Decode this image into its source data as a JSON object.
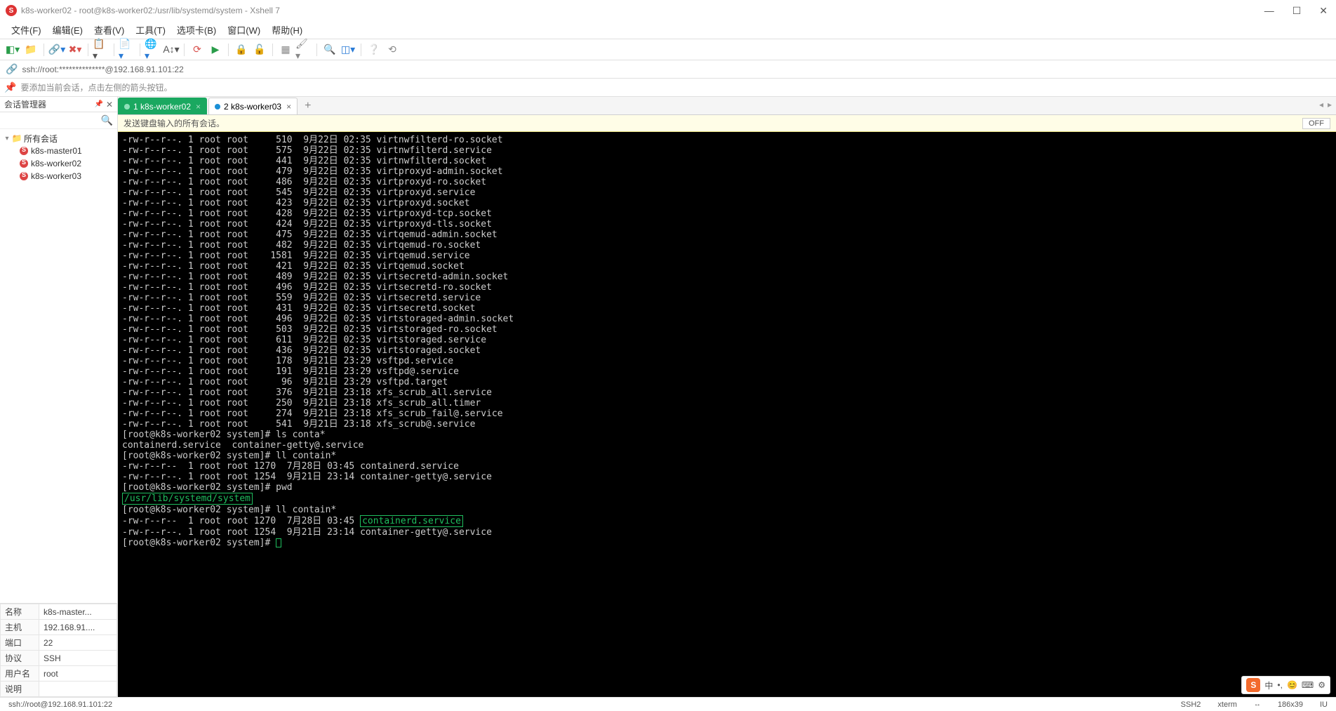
{
  "window": {
    "title": "k8s-worker02 - root@k8s-worker02:/usr/lib/systemd/system - Xshell 7",
    "min": "—",
    "max": "☐",
    "close": "✕"
  },
  "menu": {
    "file": "文件(F)",
    "edit": "编辑(E)",
    "view": "查看(V)",
    "tools": "工具(T)",
    "tabs": "选项卡(B)",
    "window": "窗口(W)",
    "help": "帮助(H)"
  },
  "address": "ssh://root:**************@192.168.91.101:22",
  "hint": "要添加当前会话，点击左侧的箭头按钮。",
  "side": {
    "title": "会话管理器",
    "root": "所有会话",
    "items": [
      "k8s-master01",
      "k8s-worker02",
      "k8s-worker03"
    ]
  },
  "props": {
    "name_k": "名称",
    "name_v": "k8s-master...",
    "host_k": "主机",
    "host_v": "192.168.91....",
    "port_k": "端口",
    "port_v": "22",
    "proto_k": "协议",
    "proto_v": "SSH",
    "user_k": "用户名",
    "user_v": "root",
    "desc_k": "说明",
    "desc_v": ""
  },
  "tabs": {
    "t1": "1 k8s-worker02",
    "t2": "2 k8s-worker03"
  },
  "bcast": {
    "text": "发送键盘输入的所有会话。",
    "off": "OFF"
  },
  "terminal": {
    "ls_lines": [
      "-rw-r--r--. 1 root root     510  9月22日 02:35 virtnwfilterd-ro.socket",
      "-rw-r--r--. 1 root root     575  9月22日 02:35 virtnwfilterd.service",
      "-rw-r--r--. 1 root root     441  9月22日 02:35 virtnwfilterd.socket",
      "-rw-r--r--. 1 root root     479  9月22日 02:35 virtproxyd-admin.socket",
      "-rw-r--r--. 1 root root     486  9月22日 02:35 virtproxyd-ro.socket",
      "-rw-r--r--. 1 root root     545  9月22日 02:35 virtproxyd.service",
      "-rw-r--r--. 1 root root     423  9月22日 02:35 virtproxyd.socket",
      "-rw-r--r--. 1 root root     428  9月22日 02:35 virtproxyd-tcp.socket",
      "-rw-r--r--. 1 root root     424  9月22日 02:35 virtproxyd-tls.socket",
      "-rw-r--r--. 1 root root     475  9月22日 02:35 virtqemud-admin.socket",
      "-rw-r--r--. 1 root root     482  9月22日 02:35 virtqemud-ro.socket",
      "-rw-r--r--. 1 root root    1581  9月22日 02:35 virtqemud.service",
      "-rw-r--r--. 1 root root     421  9月22日 02:35 virtqemud.socket",
      "-rw-r--r--. 1 root root     489  9月22日 02:35 virtsecretd-admin.socket",
      "-rw-r--r--. 1 root root     496  9月22日 02:35 virtsecretd-ro.socket",
      "-rw-r--r--. 1 root root     559  9月22日 02:35 virtsecretd.service",
      "-rw-r--r--. 1 root root     431  9月22日 02:35 virtsecretd.socket",
      "-rw-r--r--. 1 root root     496  9月22日 02:35 virtstoraged-admin.socket",
      "-rw-r--r--. 1 root root     503  9月22日 02:35 virtstoraged-ro.socket",
      "-rw-r--r--. 1 root root     611  9月22日 02:35 virtstoraged.service",
      "-rw-r--r--. 1 root root     436  9月22日 02:35 virtstoraged.socket",
      "-rw-r--r--. 1 root root     178  9月21日 23:29 vsftpd.service",
      "-rw-r--r--. 1 root root     191  9月21日 23:29 vsftpd@.service",
      "-rw-r--r--. 1 root root      96  9月21日 23:29 vsftpd.target",
      "-rw-r--r--. 1 root root     376  9月21日 23:18 xfs_scrub_all.service",
      "-rw-r--r--. 1 root root     250  9月21日 23:18 xfs_scrub_all.timer",
      "-rw-r--r--. 1 root root     274  9月21日 23:18 xfs_scrub_fail@.service",
      "-rw-r--r--. 1 root root     541  9月21日 23:18 xfs_scrub@.service"
    ],
    "p1": "[root@k8s-worker02 system]# ls conta*",
    "p1_out": "containerd.service  container-getty@.service",
    "p2": "[root@k8s-worker02 system]# ll contain*",
    "p2_out1": "-rw-r--r--  1 root root 1270  7月28日 03:45 containerd.service",
    "p2_out2": "-rw-r--r--. 1 root root 1254  9月21日 23:14 container-getty@.service",
    "p3": "[root@k8s-worker02 system]# pwd",
    "p3_out": "/usr/lib/systemd/system",
    "p4": "[root@k8s-worker02 system]# ll contain*",
    "p4_out1a": "-rw-r--r--  1 root root 1270  7月28日 03:45 ",
    "p4_out1b": "containerd.service",
    "p4_out2": "-rw-r--r--. 1 root root 1254  9月21日 23:14 container-getty@.service",
    "p5": "[root@k8s-worker02 system]# "
  },
  "status": {
    "left": "ssh://root@192.168.91.101:22",
    "ssh": "SSH2",
    "term": "xterm",
    "size": "186x39",
    "extra": "IU"
  },
  "ime": {
    "cn": "中",
    "s": "S"
  }
}
